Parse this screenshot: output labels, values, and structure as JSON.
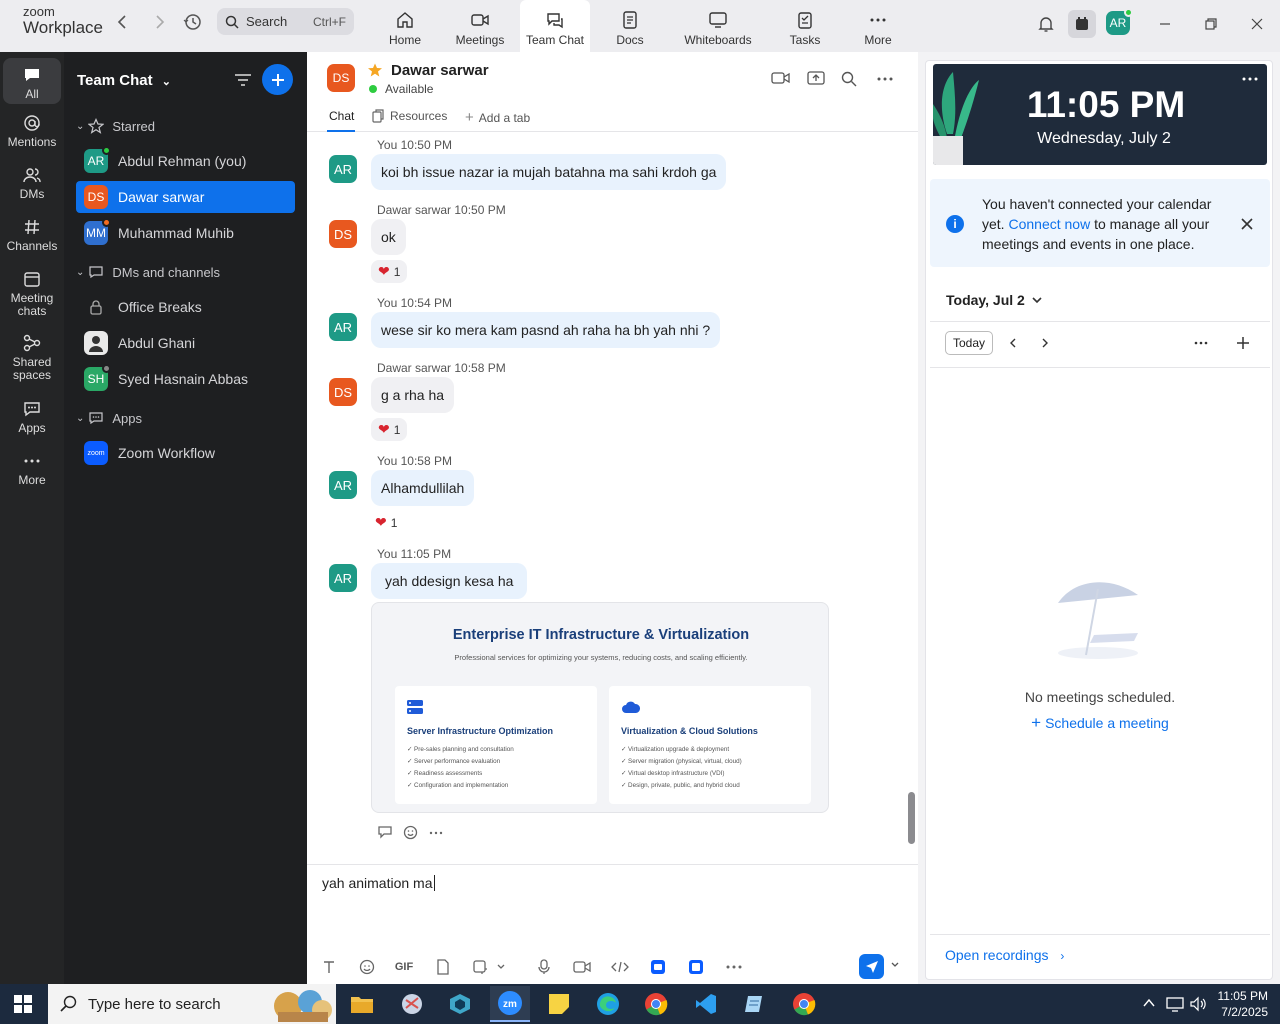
{
  "app": {
    "logo_line1": "zoom",
    "logo_line2": "Workplace",
    "search_label": "Search",
    "search_shortcut": "Ctrl+F",
    "user_initials": "AR",
    "accent": "#0e71eb"
  },
  "tabs": [
    {
      "label": "Home",
      "icon": "home-icon"
    },
    {
      "label": "Meetings",
      "icon": "video-icon"
    },
    {
      "label": "Team Chat",
      "icon": "chat-icon",
      "active": true
    },
    {
      "label": "Docs",
      "icon": "doc-icon"
    },
    {
      "label": "Whiteboards",
      "icon": "whiteboard-icon"
    },
    {
      "label": "Tasks",
      "icon": "tasks-icon"
    },
    {
      "label": "More",
      "icon": "more-icon"
    }
  ],
  "rail": [
    {
      "label": "All"
    },
    {
      "label": "Mentions"
    },
    {
      "label": "DMs"
    },
    {
      "label": "Channels"
    },
    {
      "label": "Meeting chats"
    },
    {
      "label": "Shared spaces"
    },
    {
      "label": "Apps"
    },
    {
      "label": "More"
    }
  ],
  "sidebar": {
    "title": "Team Chat",
    "starred_label": "Starred",
    "starred": [
      {
        "initials": "AR",
        "name": "Abdul Rehman (you)",
        "color": "#1e9a86"
      },
      {
        "initials": "DS",
        "name": "Dawar sarwar",
        "color": "#e8581f",
        "selected": true
      },
      {
        "initials": "MM",
        "name": "Muhammad Muhib",
        "color": "#2f6fcf"
      }
    ],
    "dms_label": "DMs and channels",
    "dms": [
      {
        "name": "Office Breaks"
      },
      {
        "name": "Abdul Ghani"
      },
      {
        "initials": "SH",
        "name": "Syed Hasnain Abbas",
        "color": "#2aa866"
      }
    ],
    "apps_label": "Apps",
    "apps": [
      {
        "initials": "zoom",
        "name": "Zoom Workflow"
      }
    ]
  },
  "chat": {
    "contact_initials": "DS",
    "contact_name": "Dawar sarwar",
    "status": "Available",
    "tabs": {
      "chat": "Chat",
      "resources": "Resources",
      "add": "Add a tab"
    },
    "messages": [
      {
        "sender": "You",
        "time": "10:50 PM",
        "initials": "AR",
        "text": "koi bh issue nazar ia mujah batahna ma sahi krdoh ga"
      },
      {
        "sender": "Dawar sarwar",
        "time": "10:50 PM",
        "initials": "DS",
        "text": "ok",
        "reaction": "1"
      },
      {
        "sender": "You",
        "time": "10:54 PM",
        "initials": "AR",
        "text": "wese sir ko mera kam pasnd ah raha ha bh yah nhi ?"
      },
      {
        "sender": "Dawar sarwar",
        "time": "10:58 PM",
        "initials": "DS",
        "text": "g a rha ha",
        "reaction": "1"
      },
      {
        "sender": "You",
        "time": "10:58 PM",
        "initials": "AR",
        "text": "Alhamdullilah",
        "reaction": "1"
      },
      {
        "sender": "You",
        "time": "11:05 PM",
        "initials": "AR",
        "text": "yah ddesign kesa ha"
      }
    ],
    "attachment": {
      "title": "Enterprise IT Infrastructure & Virtualization",
      "subtitle": "Professional services for optimizing your systems, reducing costs, and scaling efficiently.",
      "cards": [
        {
          "title": "Server Infrastructure Optimization",
          "items": [
            "Pre-sales planning and consultation",
            "Server performance evaluation",
            "Readiness assessments",
            "Configuration and implementation"
          ]
        },
        {
          "title": "Virtualization & Cloud Solutions",
          "items": [
            "Virtualization upgrade & deployment",
            "Server migration (physical, virtual, cloud)",
            "Virtual desktop infrastructure (VDI)",
            "Design, private, public, and hybrid cloud"
          ]
        }
      ]
    },
    "composer_text": "yah animation ma",
    "gif_label": "GIF"
  },
  "calendar": {
    "time": "11:05 PM",
    "date": "Wednesday, July 2",
    "notice_pre": "You haven't connected your calendar yet. ",
    "notice_link": "Connect now",
    "notice_post": " to manage all your meetings and events in one place.",
    "day_label": "Today, Jul 2",
    "today_btn": "Today",
    "empty_text": "No meetings scheduled.",
    "schedule_link": "Schedule a meeting",
    "open_recordings": "Open recordings"
  },
  "taskbar": {
    "search_placeholder": "Type here to search",
    "time": "11:05 PM",
    "date": "7/2/2025"
  }
}
